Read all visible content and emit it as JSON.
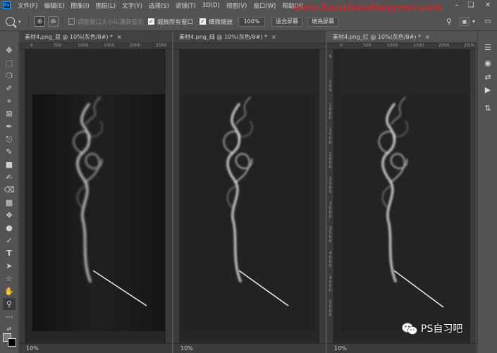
{
  "app": {
    "logo_text": "Ps",
    "menu": [
      "文件(F)",
      "编辑(E)",
      "图像(I)",
      "图层(L)",
      "文字(Y)",
      "选择(S)",
      "滤镜(T)",
      "3D(D)",
      "视图(V)",
      "窗口(W)",
      "帮助(H)"
    ],
    "watermark": "www.hanzhandiangmei.com"
  },
  "options": {
    "resize_windows_label": "调整窗口大小以满屏显示",
    "zoom_all_windows_label": "缩放所有窗口",
    "zoom_all_windows_checked": true,
    "scrubby_zoom_label": "细微缩放",
    "scrubby_zoom_checked": true,
    "zoom_value": "100%",
    "fit_screen_label": "适合屏幕",
    "fill_screen_label": "填充屏幕"
  },
  "documents": [
    {
      "title": "素材4.png_蓝 @ 10%(灰色/8#) *",
      "active": false,
      "zoom": "10%",
      "ruler_labels": [
        "0",
        "500",
        "1000",
        "1500",
        "2000",
        "2500"
      ]
    },
    {
      "title": "素材4.png_绿 @ 10%(灰色/8#) *",
      "active": false,
      "zoom": "10%",
      "ruler_labels": [
        "0",
        "500",
        "1000",
        "1500",
        "2000",
        "2500"
      ]
    },
    {
      "title": "素材4.png_红 @ 10%(灰色/8#) *",
      "active": true,
      "zoom": "10%",
      "ruler_labels": [
        "0",
        "500",
        "1000",
        "1500",
        "2000",
        "2500"
      ],
      "vertical_ruler_labels": [
        "0",
        "5\n0\n0",
        "1\n0\n0\n0",
        "1\n5\n0\n0",
        "2\n0\n0\n0",
        "2\n5\n0\n0",
        "3\n0\n0\n0",
        "3\n5\n0\n0",
        "4\n0\n0\n0",
        "4\n5\n0\n0",
        "5\n0\n0\n0"
      ]
    }
  ],
  "badge": {
    "label": "PS自习吧"
  },
  "colors": {
    "ui_bg": "#535353",
    "canvas_bg": "#1d1d1d",
    "watermark": "#d8262b"
  }
}
